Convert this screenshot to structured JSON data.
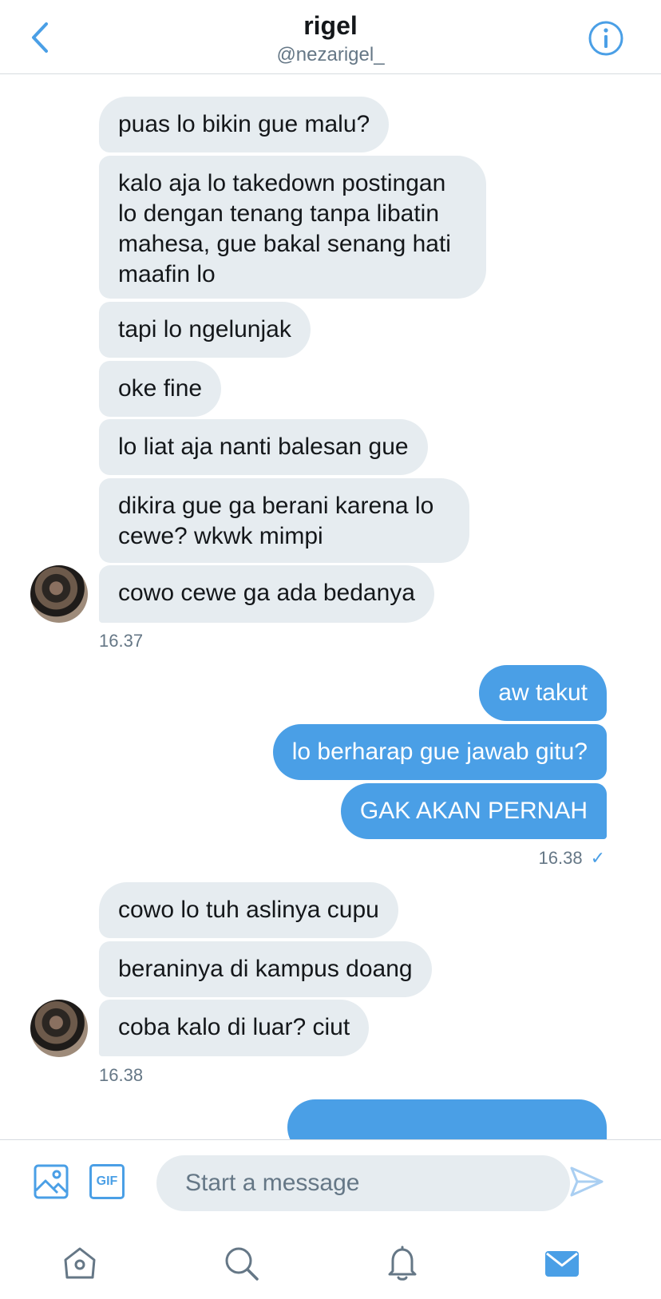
{
  "header": {
    "title": "rigel",
    "handle": "@nezarigel_",
    "back_icon": "chevron-left-icon",
    "info_icon": "info-icon"
  },
  "messages": {
    "group1": [
      "puas lo bikin gue malu?",
      "kalo aja lo takedown postingan lo dengan tenang tanpa libatin mahesa, gue bakal senang hati maafin lo",
      "tapi lo ngelunjak",
      "oke fine",
      "lo liat aja nanti balesan gue",
      "dikira gue ga berani karena lo cewe? wkwk mimpi",
      "cowo cewe ga ada bedanya"
    ],
    "group1_time": "16.37",
    "group2": [
      "aw takut",
      "lo berharap gue jawab gitu?",
      "GAK AKAN PERNAH"
    ],
    "group2_time": "16.38",
    "group2_check": "✓",
    "group3": [
      "cowo lo tuh aslinya cupu",
      "beraninya di kampus doang",
      "coba kalo di luar? ciut"
    ],
    "group3_time": "16.38"
  },
  "composer": {
    "placeholder": "Start a message",
    "image_icon": "image-icon",
    "gif_label": "GIF",
    "send_icon": "send-icon"
  },
  "tabbar": {
    "items": [
      "home-icon",
      "search-icon",
      "notifications-icon",
      "messages-icon"
    ]
  },
  "colors": {
    "accent": "#4a9fe6",
    "incoming_bubble": "#e6ecf0",
    "muted_text": "#657786"
  }
}
